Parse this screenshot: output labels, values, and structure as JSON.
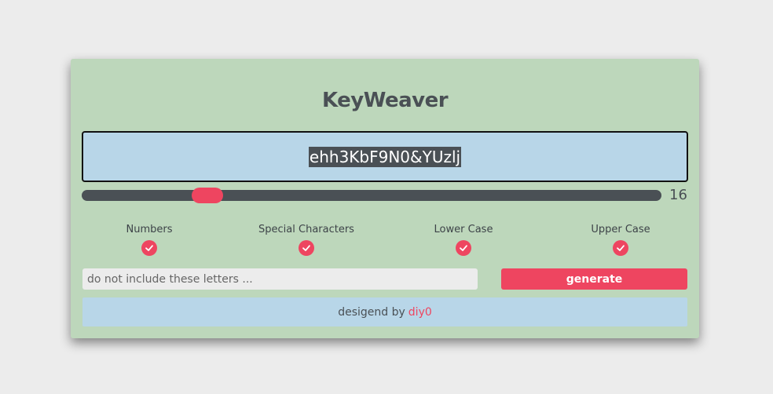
{
  "app": {
    "title": "KeyWeaver"
  },
  "password": {
    "value": "ehh3KbF9N0&YUzlj"
  },
  "length": {
    "value": "16",
    "min": 4,
    "max": 64
  },
  "options": [
    {
      "label": "Numbers",
      "checked": true
    },
    {
      "label": "Special Characters",
      "checked": true
    },
    {
      "label": "Lower Case",
      "checked": true
    },
    {
      "label": "Upper Case",
      "checked": true
    }
  ],
  "exclude": {
    "placeholder": "do not include these letters ...",
    "value": ""
  },
  "generate": {
    "label": "generate"
  },
  "footer": {
    "text": "desigend by",
    "author": "diy0"
  },
  "colors": {
    "card_background": "#bdd7bb",
    "accent": "#ee4560",
    "panel_blue": "#b8d6e8",
    "dark": "#4a5055"
  }
}
